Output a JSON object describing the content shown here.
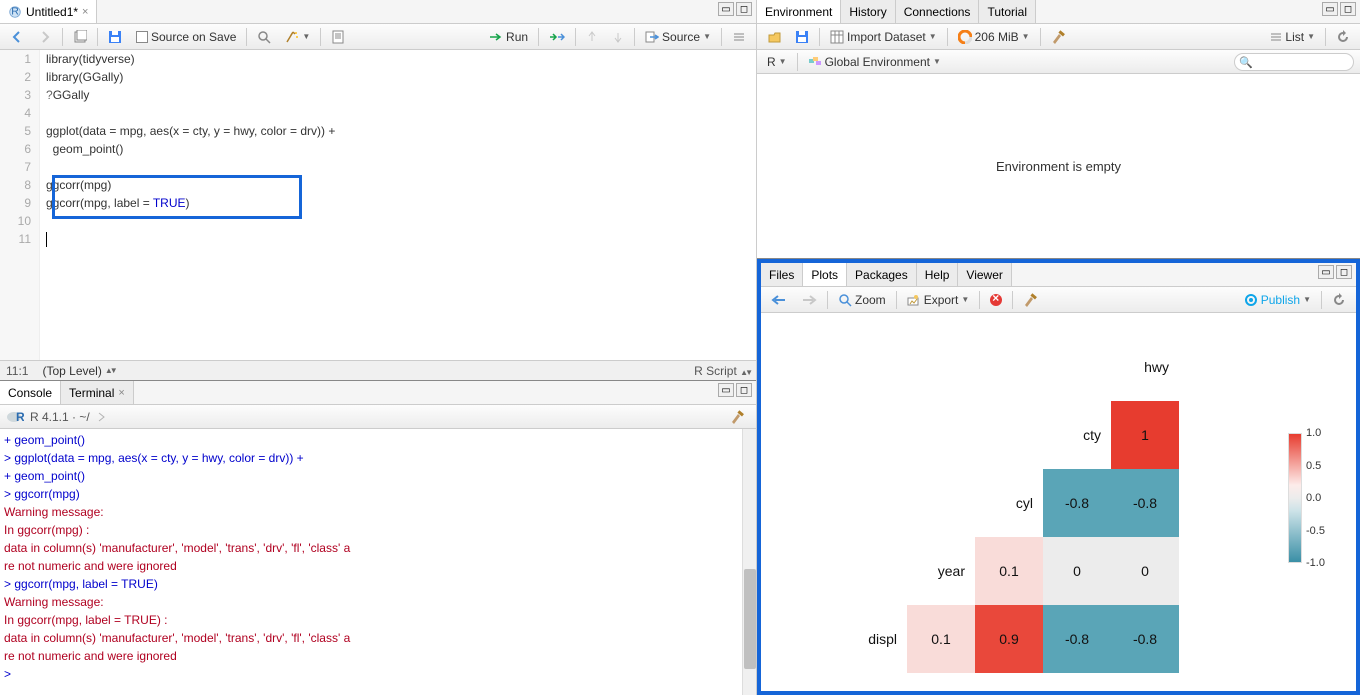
{
  "source": {
    "tab_title": "Untitled1*",
    "toolbar": {
      "source_on_save": "Source on Save",
      "run": "Run",
      "source_btn": "Source"
    },
    "lines": [
      "library(tidyverse)",
      "library(GGally)",
      "?GGally",
      "",
      "ggplot(data = mpg, aes(x = cty, y = hwy, color = drv)) +",
      "  geom_point()",
      "",
      "ggcorr(mpg)",
      "ggcorr(mpg, label = TRUE)",
      "",
      ""
    ],
    "status": {
      "pos": "11:1",
      "scope": "(Top Level)",
      "lang": "R Script"
    }
  },
  "console": {
    "tab1": "Console",
    "tab2": "Terminal",
    "version": "R 4.1.1 · ~/",
    "lines": [
      {
        "t": "cont",
        "s": "+   geom_point()"
      },
      {
        "t": "cmd",
        "s": "> ggplot(data = mpg, aes(x = cty, y = hwy, color = drv)) +"
      },
      {
        "t": "cont",
        "s": "+   geom_point()"
      },
      {
        "t": "cmd",
        "s": "> ggcorr(mpg)"
      },
      {
        "t": "warn",
        "s": "Warning message:"
      },
      {
        "t": "warn",
        "s": "In ggcorr(mpg) :"
      },
      {
        "t": "warn",
        "s": "  data in column(s) 'manufacturer', 'model', 'trans', 'drv', 'fl', 'class' a"
      },
      {
        "t": "warn",
        "s": "re not numeric and were ignored"
      },
      {
        "t": "cmd",
        "s": "> ggcorr(mpg, label = TRUE)"
      },
      {
        "t": "warn",
        "s": "Warning message:"
      },
      {
        "t": "warn",
        "s": "In ggcorr(mpg, label = TRUE) :"
      },
      {
        "t": "warn",
        "s": "  data in column(s) 'manufacturer', 'model', 'trans', 'drv', 'fl', 'class' a"
      },
      {
        "t": "warn",
        "s": "re not numeric and were ignored"
      },
      {
        "t": "cmd",
        "s": "> "
      }
    ]
  },
  "env": {
    "tabs": [
      "Environment",
      "History",
      "Connections",
      "Tutorial"
    ],
    "import": "Import Dataset",
    "mem": "206 MiB",
    "list": "List",
    "scope_r": "R",
    "scope_env": "Global Environment",
    "empty": "Environment is empty"
  },
  "plots": {
    "tabs": [
      "Files",
      "Plots",
      "Packages",
      "Help",
      "Viewer"
    ],
    "zoom": "Zoom",
    "export": "Export",
    "publish": "Publish"
  },
  "chart_data": {
    "type": "heatmap",
    "title": "",
    "variables": [
      "displ",
      "year",
      "cyl",
      "cty",
      "hwy"
    ],
    "row_labels_top_to_bottom": [
      "hwy",
      "cty",
      "cyl",
      "year",
      "displ"
    ],
    "cells": [
      {
        "row": "cty",
        "col": "hwy",
        "val": 1,
        "color": "#e73c2f"
      },
      {
        "row": "cyl",
        "col": "cty",
        "val": -0.8,
        "color": "#5aa5b7"
      },
      {
        "row": "cyl",
        "col": "hwy",
        "val": -0.8,
        "color": "#5aa5b7"
      },
      {
        "row": "year",
        "col": "cyl",
        "val": 0.1,
        "color": "#f9dcd9"
      },
      {
        "row": "year",
        "col": "cty",
        "val": 0,
        "color": "#ececec"
      },
      {
        "row": "year",
        "col": "hwy",
        "val": 0,
        "color": "#ececec"
      },
      {
        "row": "displ",
        "col": "year",
        "val": 0.1,
        "color": "#f9dcd9"
      },
      {
        "row": "displ",
        "col": "cyl",
        "val": 0.9,
        "color": "#e9483b"
      },
      {
        "row": "displ",
        "col": "cty",
        "val": -0.8,
        "color": "#5aa5b7"
      },
      {
        "row": "displ",
        "col": "hwy",
        "val": -0.8,
        "color": "#5aa5b7"
      }
    ],
    "legend": {
      "min": -1.0,
      "max": 1.0,
      "ticks": [
        1.0,
        0.5,
        0.0,
        -0.5,
        -1.0
      ]
    }
  }
}
